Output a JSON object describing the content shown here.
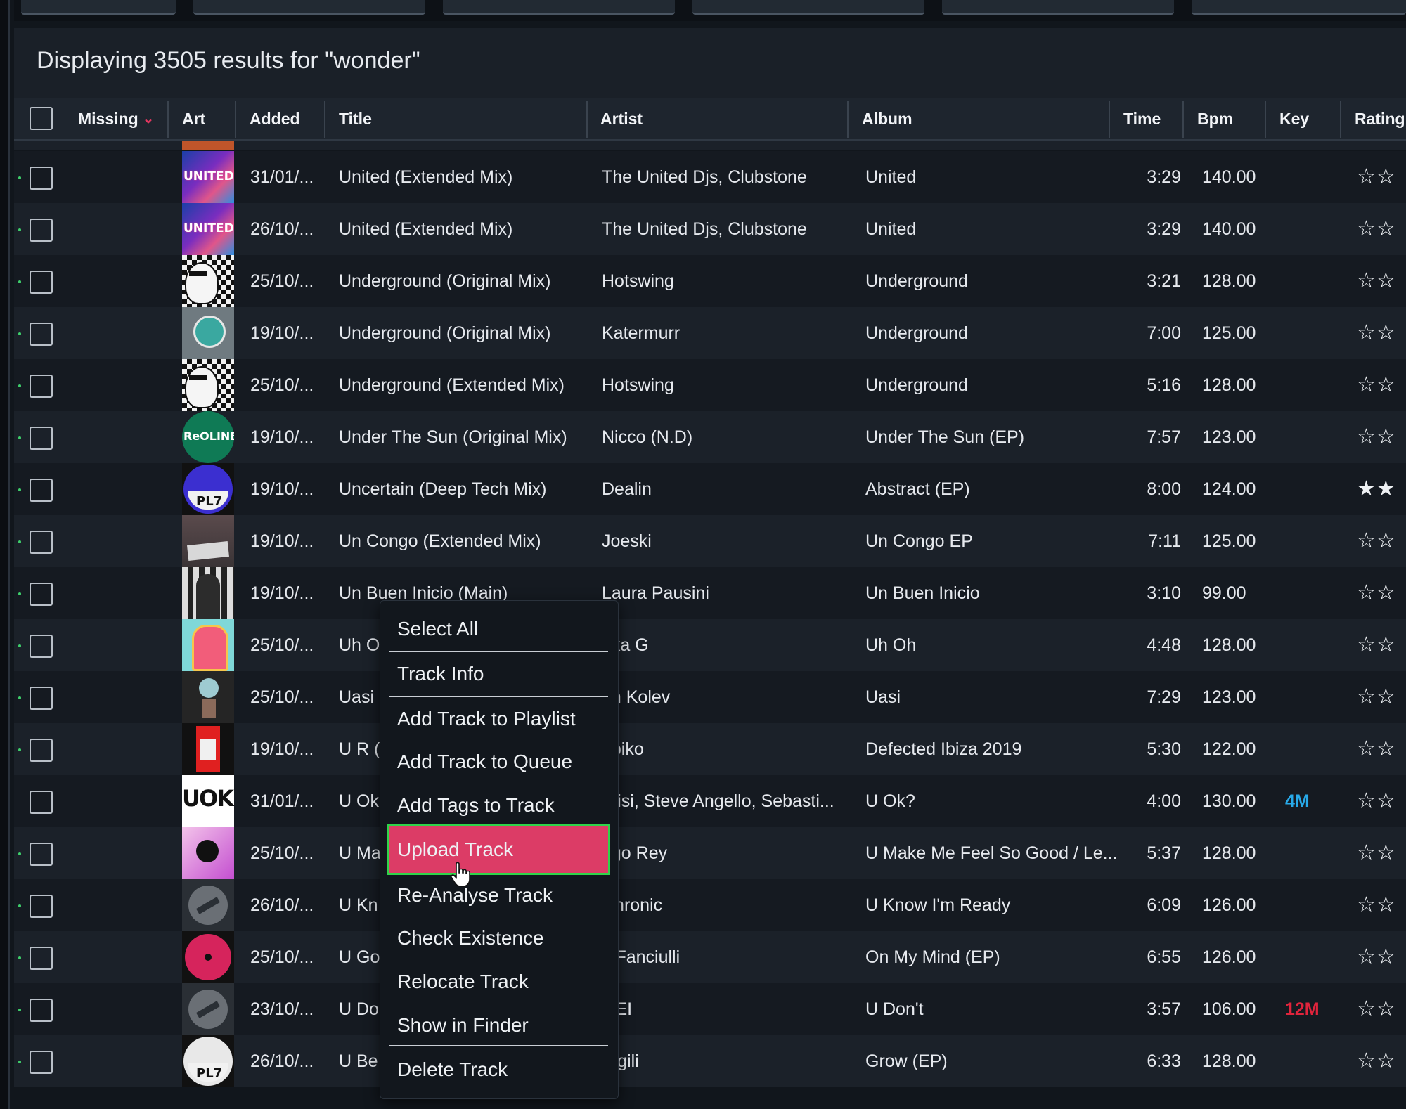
{
  "results_text": "Displaying 3505 results for \"wonder\"",
  "columns": {
    "missing": "Missing",
    "art": "Art",
    "added": "Added",
    "title": "Title",
    "artist": "Artist",
    "album": "Album",
    "time": "Time",
    "bpm": "Bpm",
    "key": "Key",
    "rating": "Rating"
  },
  "rows": [
    {
      "added": "31/01/...",
      "title": "United (Extended Mix)",
      "artist": "The United Djs, Clubstone",
      "album": "United",
      "time": "3:29",
      "bpm": "140.00",
      "key": "",
      "rating": "☆☆",
      "cover": "united-cover"
    },
    {
      "added": "26/10/...",
      "title": "United (Extended Mix)",
      "artist": "The United Djs, Clubstone",
      "album": "United",
      "time": "3:29",
      "bpm": "140.00",
      "key": "",
      "rating": "☆☆",
      "cover": "united-cover"
    },
    {
      "added": "25/10/...",
      "title": "Underground (Original Mix)",
      "artist": "Hotswing",
      "album": "Underground",
      "time": "3:21",
      "bpm": "128.00",
      "key": "",
      "rating": "☆☆",
      "cover": "hotswing-cover"
    },
    {
      "added": "19/10/...",
      "title": "Underground (Original Mix)",
      "artist": "Katermurr",
      "album": "Underground",
      "time": "7:00",
      "bpm": "125.00",
      "key": "",
      "rating": "☆☆",
      "cover": "katermurr-cover"
    },
    {
      "added": "25/10/...",
      "title": "Underground (Extended Mix)",
      "artist": "Hotswing",
      "album": "Underground",
      "time": "5:16",
      "bpm": "128.00",
      "key": "",
      "rating": "☆☆",
      "cover": "hotswing-cover"
    },
    {
      "added": "19/10/...",
      "title": "Under The Sun (Original Mix)",
      "artist": "Nicco (N.D)",
      "album": "Under The Sun (EP)",
      "time": "7:57",
      "bpm": "123.00",
      "key": "",
      "rating": "☆☆",
      "cover": "green-label-cover"
    },
    {
      "added": "19/10/...",
      "title": "Uncertain (Deep Tech Mix)",
      "artist": "Dealin",
      "album": "Abstract (EP)",
      "time": "8:00",
      "bpm": "124.00",
      "key": "",
      "rating": "★★",
      "cover": "pl7-cover"
    },
    {
      "added": "19/10/...",
      "title": "Un Congo (Extended Mix)",
      "artist": "Joeski",
      "album": "Un Congo EP",
      "time": "7:11",
      "bpm": "125.00",
      "key": "",
      "rating": "☆☆",
      "cover": "joeski-cover"
    },
    {
      "added": "19/10/...",
      "title": "Un Buen Inicio (Main)",
      "artist": "Laura Pausini",
      "album": "Un Buen Inicio",
      "time": "3:10",
      "bpm": "99.00",
      "key": "",
      "rating": "☆☆",
      "cover": "pausini-cover"
    },
    {
      "added": "25/10/...",
      "title": "Uh O",
      "artist": "aka G",
      "album": "Uh Oh",
      "time": "4:48",
      "bpm": "128.00",
      "key": "",
      "rating": "☆☆",
      "cover": "jukebox-cover"
    },
    {
      "added": "25/10/...",
      "title": "Uasi",
      "artist": "an Kolev",
      "album": "Uasi",
      "time": "7:29",
      "bpm": "123.00",
      "key": "",
      "rating": "☆☆",
      "cover": "uasi-cover"
    },
    {
      "added": "19/10/...",
      "title": "U R (",
      "artist": "ubiko",
      "album": "Defected Ibiza 2019",
      "time": "5:30",
      "bpm": "122.00",
      "key": "",
      "rating": "☆☆",
      "cover": "defected-cover"
    },
    {
      "added": "31/01/...",
      "title": "U Ok",
      "artist": "arisi, Steve Angello, Sebasti...",
      "album": "U Ok?",
      "time": "4:00",
      "bpm": "130.00",
      "key": "4M",
      "rating": "☆☆",
      "cover": "uok-cover"
    },
    {
      "added": "25/10/...",
      "title": "U Ma",
      "artist": "ego Rey",
      "album": "U Make Me Feel So Good / Le...",
      "time": "5:37",
      "bpm": "128.00",
      "key": "",
      "rating": "☆☆",
      "cover": "pink-cover"
    },
    {
      "added": "26/10/...",
      "title": "U Kn",
      "artist": "Chronic",
      "album": "U Know I'm Ready",
      "time": "6:09",
      "bpm": "126.00",
      "key": "",
      "rating": "☆☆",
      "cover": "default-cover"
    },
    {
      "added": "25/10/...",
      "title": "U Go",
      "artist": "c Fanciulli",
      "album": "On My Mind (EP)",
      "time": "6:55",
      "bpm": "126.00",
      "key": "",
      "rating": "☆☆",
      "cover": "red-vinyl-cover"
    },
    {
      "added": "23/10/...",
      "title": "U Do",
      "artist": "GEI",
      "album": "U Don't",
      "time": "3:57",
      "bpm": "106.00",
      "key": "12M",
      "rating": "☆☆",
      "cover": "default-cover"
    },
    {
      "added": "26/10/...",
      "title": "U Be",
      "artist": "ergili",
      "album": "Grow (EP)",
      "time": "6:33",
      "bpm": "128.00",
      "key": "",
      "rating": "☆☆",
      "cover": "pl7-cover"
    }
  ],
  "cover_text": {
    "united": "UNITED",
    "pl7": "PL7",
    "uok": "UOK?",
    "green": "ReOLINE"
  },
  "key_colors": {
    "4M": "#28a9e8",
    "12M": "#e0243c"
  },
  "context_menu": {
    "items": [
      "Select All",
      "Track Info",
      "Add Track to Playlist",
      "Add Track to Queue",
      "Add Tags to Track",
      "Upload Track",
      "Re-Analyse Track",
      "Check Existence",
      "Relocate Track",
      "Show in Finder",
      "Delete Track"
    ],
    "highlighted": "Upload Track",
    "highlight_color": "#dc3c66",
    "outline_color": "#2fd44a"
  }
}
